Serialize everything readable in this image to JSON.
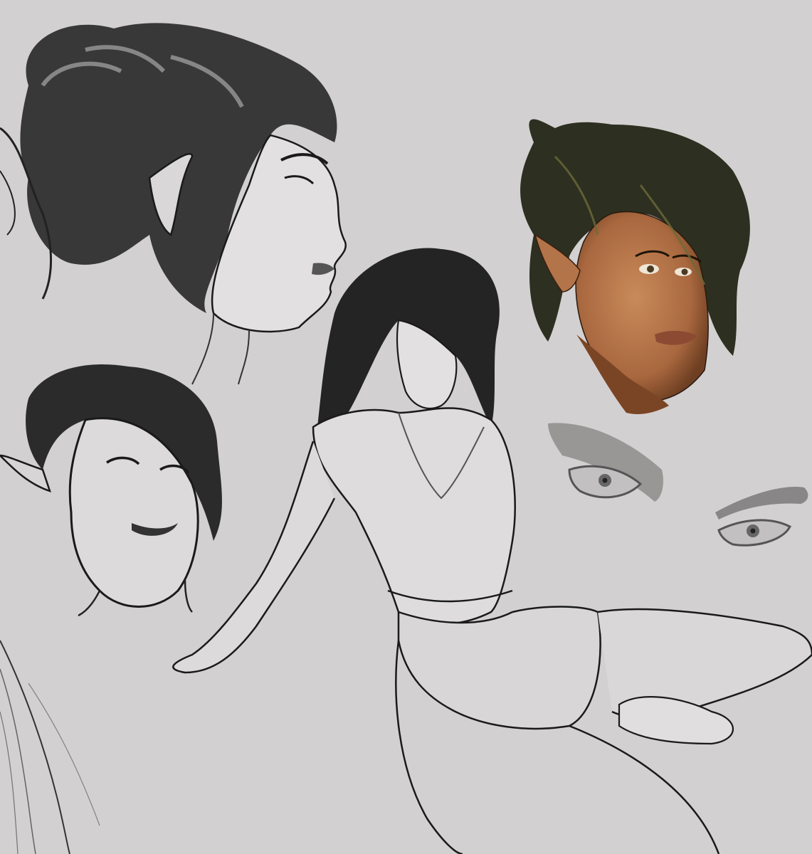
{
  "artwork": {
    "background_color": "#d3d0d1",
    "ink_color": "#1a1a1a",
    "skin_color": "#b8764a",
    "hair_color": "#2a2c1e",
    "hair_highlight_color": "#6b6a3a",
    "sketches": [
      {
        "id": "profile-head",
        "kind": "monochrome ink sketch"
      },
      {
        "id": "smiling-head",
        "kind": "monochrome ink sketch"
      },
      {
        "id": "seated-figure",
        "kind": "monochrome figure study"
      },
      {
        "id": "color-portrait",
        "kind": "color painted portrait"
      },
      {
        "id": "eye-studies",
        "kind": "grey eye studies"
      },
      {
        "id": "edge-strokes",
        "kind": "loose pencil lines"
      }
    ]
  }
}
